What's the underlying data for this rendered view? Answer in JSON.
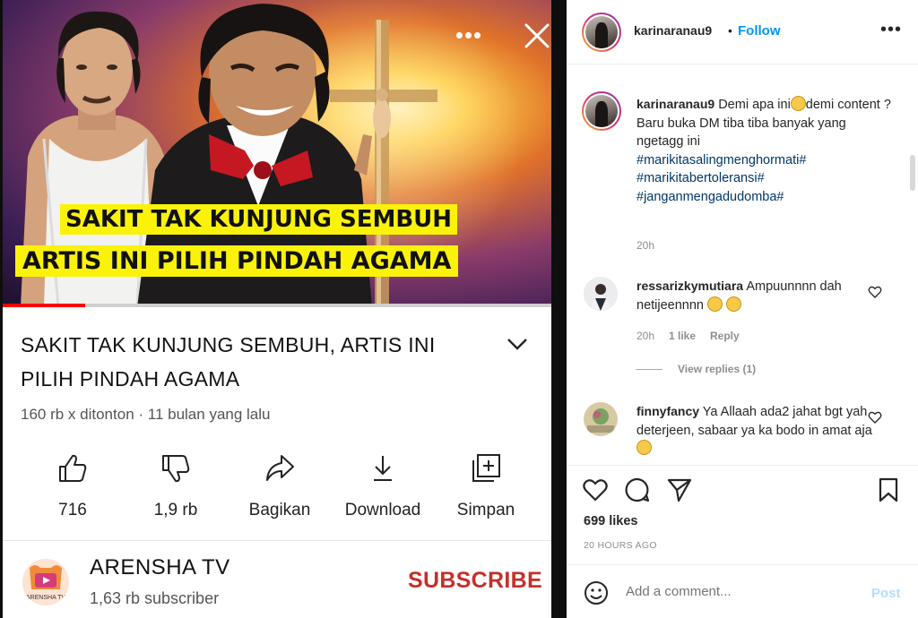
{
  "video": {
    "thumbnail_caption_1": "SAKIT TAK KUNJUNG SEMBUH",
    "thumbnail_caption_2": "ARTIS INI PILIH PINDAH AGAMA",
    "progress": 0.15,
    "title": "SAKIT TAK KUNJUNG SEMBUH, ARTIS INI PILIH PINDAH AGAMA",
    "meta": "160 rb x ditonton · 11 bulan yang lalu",
    "actions": [
      {
        "icon": "thumbs-up-icon",
        "label": "716"
      },
      {
        "icon": "thumbs-down-icon",
        "label": "1,9 rb"
      },
      {
        "icon": "share-icon",
        "label": "Bagikan"
      },
      {
        "icon": "download-icon",
        "label": "Download"
      },
      {
        "icon": "save-playlist-icon",
        "label": "Simpan"
      }
    ],
    "channel": {
      "name": "ARENSHA TV",
      "logo_text": "ARENSHA TV",
      "subscribers": "1,63 rb subscriber",
      "subscribe_label": "SUBSCRIBE"
    }
  },
  "instagram": {
    "header": {
      "username": "karinaranau9",
      "dot": "•",
      "follow_label": "Follow",
      "more": "•••"
    },
    "caption": {
      "username": "karinaranau9",
      "text_1": "Demi apa ini",
      "text_2": "demi content ?",
      "text_3": "Baru buka DM tiba tiba banyak yang ngetagg ini",
      "hashtags": [
        "#marikitasalingmenghormati#",
        "#marikitabertoleransi#",
        "#janganmengadudomba#"
      ],
      "time": "20h"
    },
    "comments": [
      {
        "username": "ressarizkymutiara",
        "text": "Ampuunnnn dah netijeennnn",
        "time": "20h",
        "likes": "1 like",
        "reply": "Reply",
        "view_replies": "View replies (1)"
      },
      {
        "username": "finnyfancy",
        "text": "Ya Allaah ada2 jahat bgt yah deterjeen, sabaar ya ka bodo in amat aja"
      }
    ],
    "likes": "699 likes",
    "post_time": "20 HOURS AGO",
    "add_comment_placeholder": "Add a comment...",
    "post_label": "Post"
  },
  "colors": {
    "ig_blue": "#0095f6",
    "subscribe_red": "#c4302b",
    "caption_yellow": "#fbf20a",
    "hashtag": "#00376b"
  }
}
